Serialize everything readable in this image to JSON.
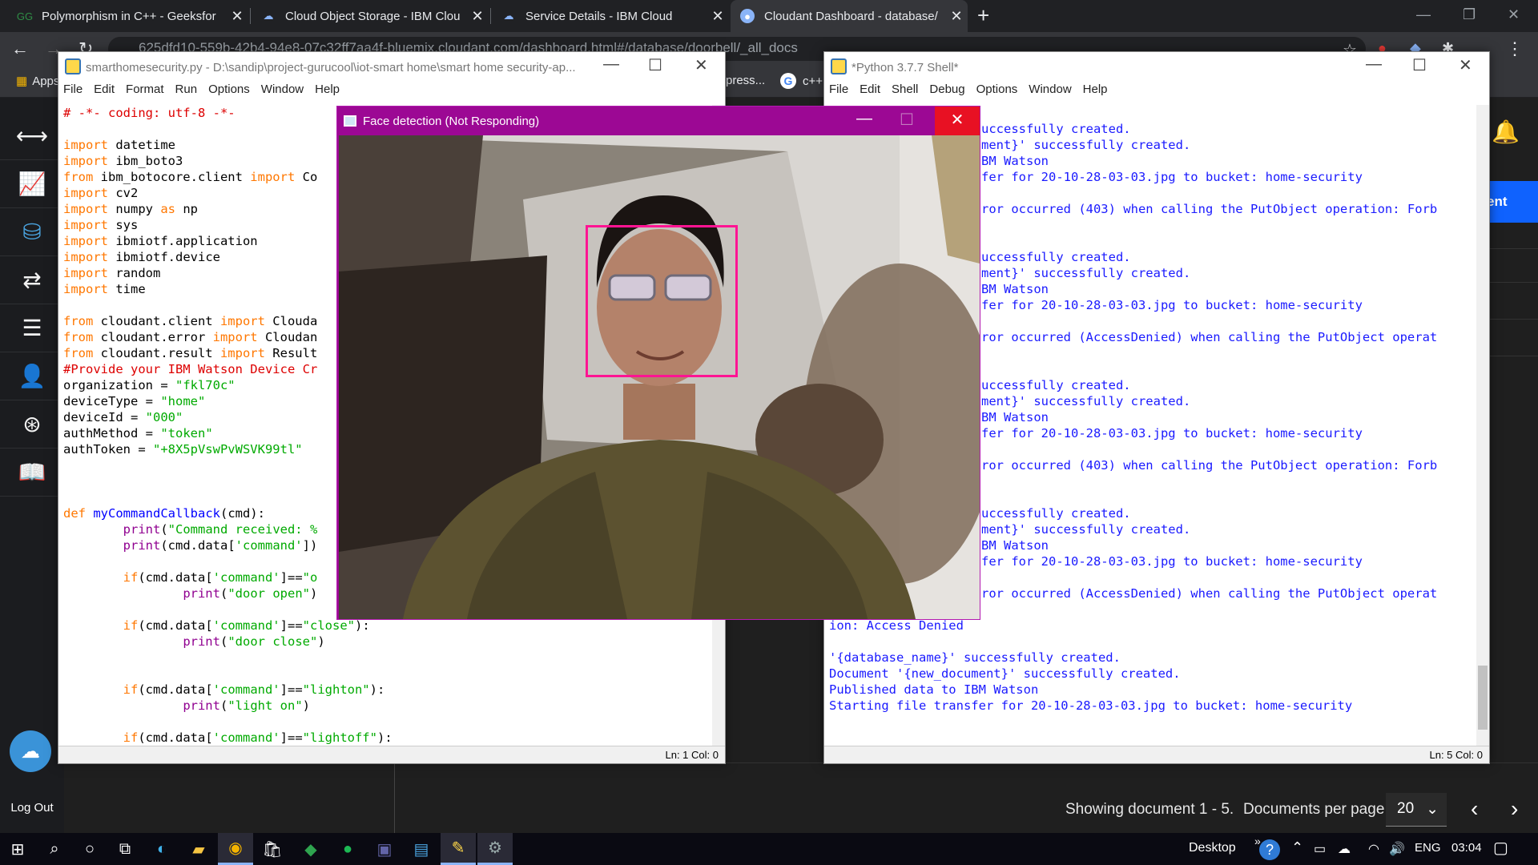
{
  "browser": {
    "tabs": [
      {
        "title": "Polymorphism in C++ - Geeksfor",
        "icon": "geeksforgeeks-icon"
      },
      {
        "title": "Cloud Object Storage - IBM Clou",
        "icon": "ibm-cloud-icon"
      },
      {
        "title": "Service Details - IBM Cloud",
        "icon": "ibm-cloud-icon"
      },
      {
        "title": "Cloudant Dashboard - database/",
        "icon": "cloudant-icon",
        "active": true
      }
    ],
    "url": "625dfd10-559b-42b4-94e8-07c32ff7aa4f-bluemix.cloudant.com/dashboard.html#/database/doorbell/_all_docs",
    "bookmarks": [
      "Apps",
      "press...",
      "c++"
    ]
  },
  "cloudant": {
    "showing": "Showing document 1 - 5.",
    "per_page_label": "Documents per page:",
    "per_page_value": "20",
    "logout": "Log Out",
    "right_button": "ent"
  },
  "editor": {
    "title": "smarthomesecurity.py - D:\\sandip\\project-gurucool\\iot-smart home\\smart home security-ap...",
    "menu": [
      "File",
      "Edit",
      "Format",
      "Run",
      "Options",
      "Window",
      "Help"
    ],
    "status": "Ln: 1   Col: 0",
    "code": [
      "# -*- coding: utf-8 -*-",
      "",
      "import datetime",
      "import ibm_boto3",
      "from ibm_botocore.client import Co",
      "import cv2",
      "import numpy as np",
      "import sys",
      "import ibmiotf.application",
      "import ibmiotf.device",
      "import random",
      "import time",
      "",
      "from cloudant.client import Clouda",
      "from cloudant.error import Cloudan",
      "from cloudant.result import Result",
      "#Provide your IBM Watson Device Cr",
      "organization = \"fkl70c\"",
      "deviceType = \"home\"",
      "deviceId = \"000\"",
      "authMethod = \"token\"",
      "authToken = \"+8X5pVswPvWSVK99tl\"",
      "",
      "",
      "",
      "def myCommandCallback(cmd):",
      "        print(\"Command received: %",
      "        print(cmd.data['command'])",
      "",
      "        if(cmd.data['command']==\"o",
      "                print(\"door open\")",
      "",
      "        if(cmd.data['command']==\"close\"):",
      "                print(\"door close\")",
      "",
      "",
      "        if(cmd.data['command']==\"lighton\"):",
      "                print(\"light on\")",
      "",
      "        if(cmd.data['command']==\"lightoff\"):"
    ]
  },
  "shell": {
    "title": "*Python 3.7.7 Shell*",
    "menu": [
      "File",
      "Edit",
      "Shell",
      "Debug",
      "Options",
      "Window",
      "Help"
    ],
    "status": "Ln: 5   Col: 0",
    "lines_partial": [
      "",
      "uccessfully created.",
      "ment}' successfully created.",
      "BM Watson",
      "fer for 20-10-28-03-03.jpg to bucket: home-security",
      "",
      "ror occurred (403) when calling the PutObject operation: Forb",
      "",
      "",
      "uccessfully created.",
      "ment}' successfully created.",
      "BM Watson",
      "fer for 20-10-28-03-03.jpg to bucket: home-security",
      "",
      "ror occurred (AccessDenied) when calling the PutObject operat",
      "",
      "",
      "uccessfully created.",
      "ment}' successfully created.",
      "BM Watson",
      "fer for 20-10-28-03-03.jpg to bucket: home-security",
      "",
      "ror occurred (403) when calling the PutObject operation: Forb",
      "",
      "",
      "uccessfully created.",
      "ment}' successfully created.",
      "BM Watson",
      "fer for 20-10-28-03-03.jpg to bucket: home-security",
      "",
      "ror occurred (AccessDenied) when calling the PutObject operat"
    ],
    "lines_full": [
      "ion: Access Denied",
      "",
      "'{database_name}' successfully created.",
      "Document '{new_document}' successfully created.",
      "Published data to IBM Watson",
      "Starting file transfer for 20-10-28-03-03.jpg to bucket: home-security"
    ]
  },
  "face_window": {
    "title": "Face detection (Not Responding)"
  },
  "taskbar": {
    "desktop": "Desktop",
    "lang": "ENG",
    "time": "03:04"
  },
  "colors": {
    "face_title": "#9c0894",
    "face_box": "#ff1493",
    "idle_keyword": "#ff7700",
    "idle_string": "#00aa00",
    "shell_output": "#1a1aff"
  }
}
